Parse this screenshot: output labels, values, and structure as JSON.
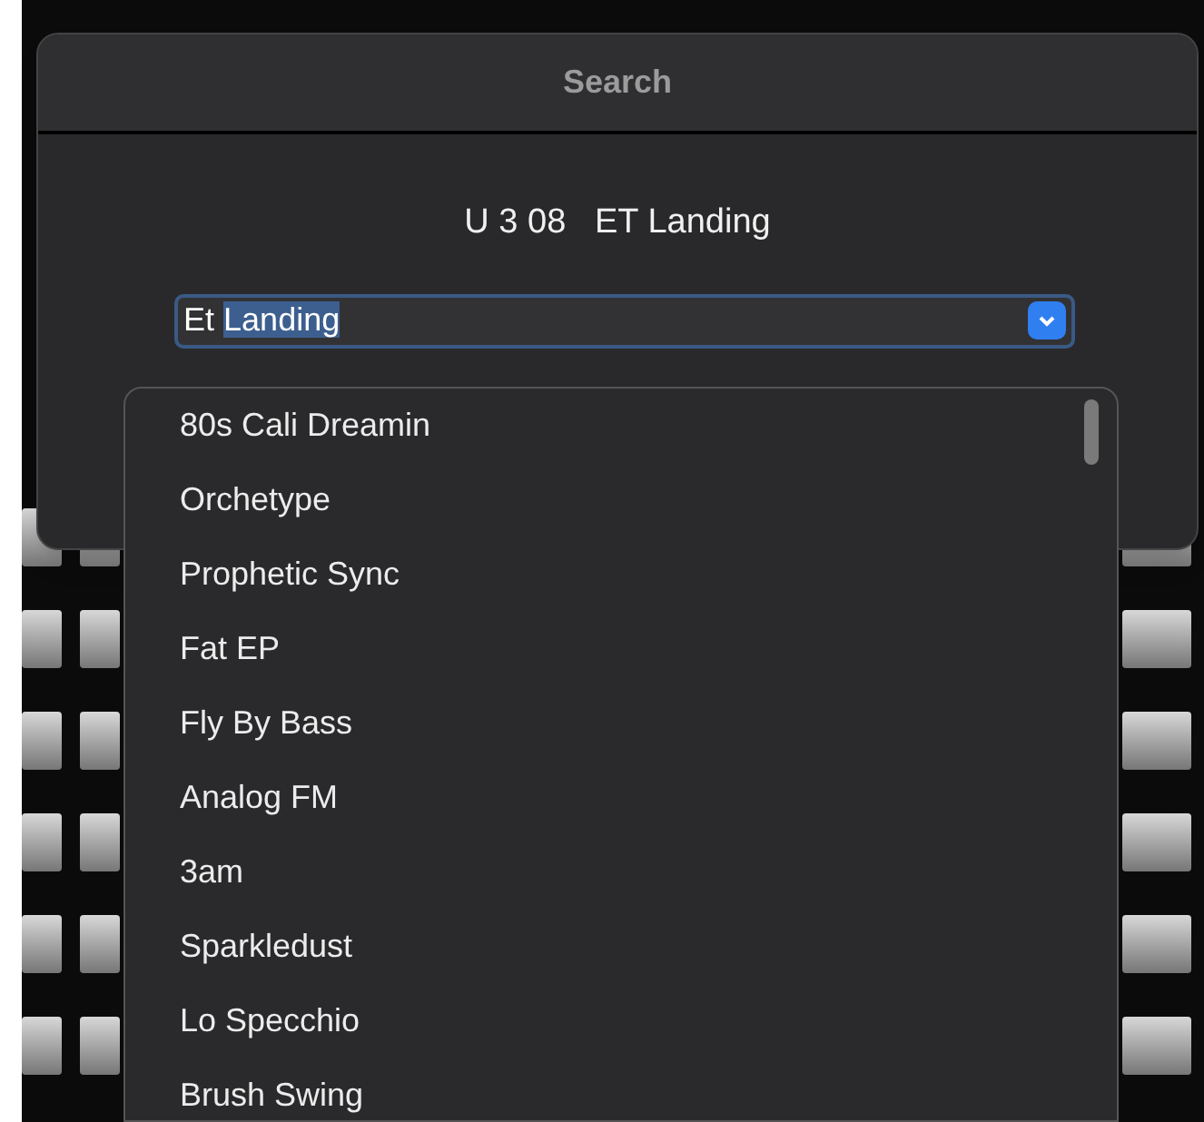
{
  "dialog": {
    "title": "Search",
    "heading": "U 3 08   ET Landing"
  },
  "search_field": {
    "parts": [
      {
        "text": "Et",
        "selected": false
      },
      {
        "text": "Landing",
        "selected": true
      }
    ]
  },
  "dropdown": {
    "items": [
      {
        "label": "80s Cali Dreamin"
      },
      {
        "label": "Orchetype"
      },
      {
        "label": "Prophetic Sync"
      },
      {
        "label": "Fat EP"
      },
      {
        "label": "Fly By Bass"
      },
      {
        "label": "Analog FM"
      },
      {
        "label": "3am"
      },
      {
        "label": "Sparkledust"
      },
      {
        "label": "Lo Specchio"
      },
      {
        "label": "Brush Swing"
      }
    ]
  }
}
